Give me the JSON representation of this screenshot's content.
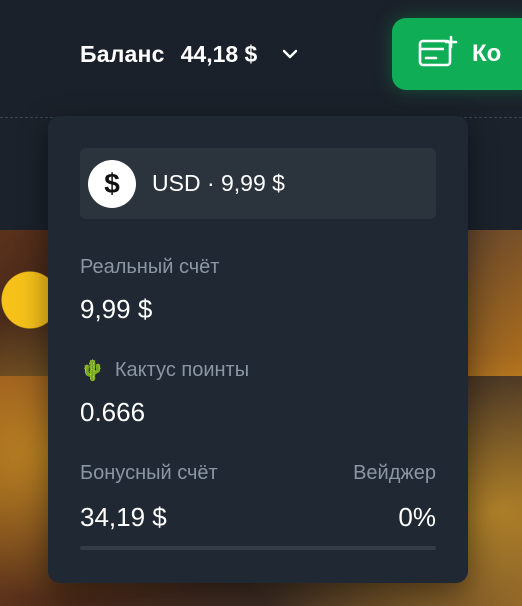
{
  "header": {
    "balance_label": "Баланс",
    "balance_value": "44,18 $",
    "wallet_button_label": "Ко"
  },
  "dropdown": {
    "currency_symbol": "$",
    "currency_text": "USD · 9,99 $",
    "real_account_label": "Реальный счёт",
    "real_account_value": "9,99 $",
    "cactus_icon": "🌵",
    "cactus_points_label": "Кактус поинты",
    "cactus_points_value": "0.666",
    "bonus_account_label": "Бонусный счёт",
    "bonus_account_value": "34,19 $",
    "wager_label": "Вейджер",
    "wager_value": "0%",
    "wager_progress": 0
  },
  "colors": {
    "accent": "#0fae56",
    "panel": "#202833",
    "muted_text": "#8b96a3"
  }
}
